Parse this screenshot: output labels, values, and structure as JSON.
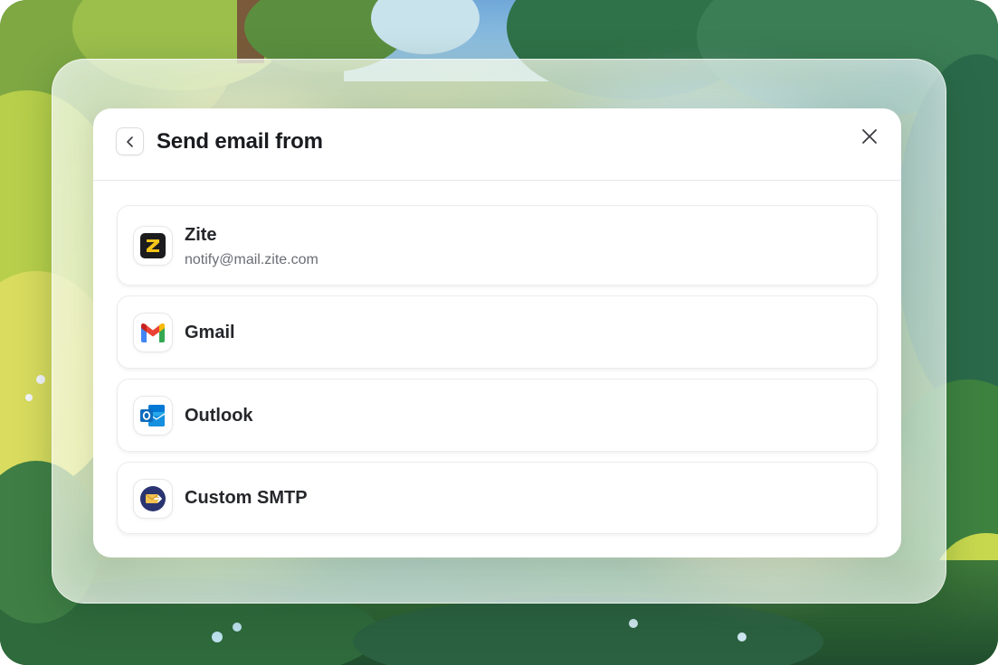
{
  "dialog": {
    "title": "Send email from",
    "back_icon": "chevron-left-icon",
    "close_icon": "close-icon"
  },
  "providers": [
    {
      "name": "Zite",
      "detail": "notify@mail.zite.com",
      "icon": "zite-logo-icon"
    },
    {
      "name": "Gmail",
      "detail": "",
      "icon": "gmail-logo-icon"
    },
    {
      "name": "Outlook",
      "detail": "",
      "icon": "outlook-logo-icon"
    },
    {
      "name": "Custom SMTP",
      "detail": "",
      "icon": "smtp-envelope-icon"
    }
  ],
  "colors": {
    "title_text": "#1a1b1f",
    "option_text": "#26272b",
    "secondary_text": "#6b6d74",
    "zite_yellow": "#f5c518",
    "gmail_red": "#ea4335",
    "outlook_blue": "#0f6cbd",
    "smtp_navy": "#2a3470"
  }
}
